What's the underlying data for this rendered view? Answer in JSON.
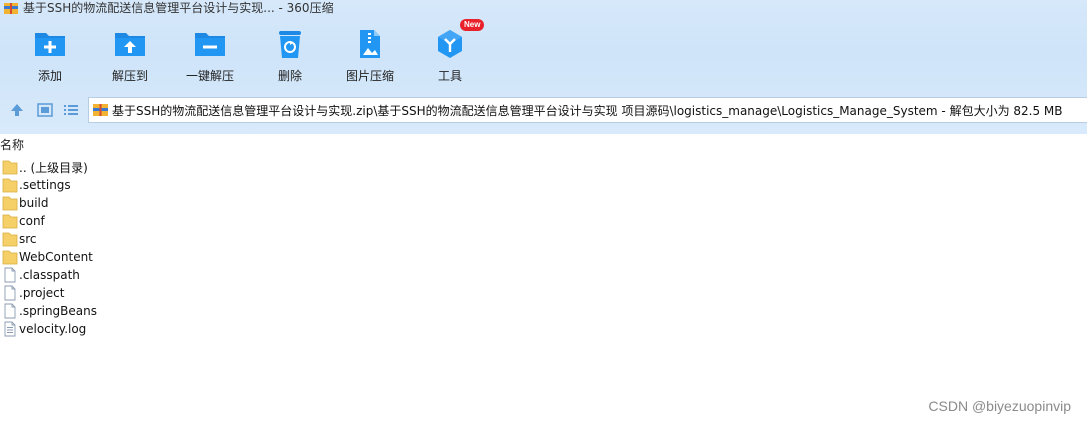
{
  "window": {
    "title": "基于SSH的物流配送信息管理平台设计与实现... - 360压缩"
  },
  "toolbar": {
    "add_label": "添加",
    "extract_to_label": "解压到",
    "one_click_extract_label": "一键解压",
    "delete_label": "删除",
    "image_compress_label": "图片压缩",
    "tools_label": "工具",
    "tools_badge": "New"
  },
  "address": {
    "path": "基于SSH的物流配送信息管理平台设计与实现.zip\\基于SSH的物流配送信息管理平台设计与实现 项目源码\\logistics_manage\\Logistics_Manage_System - 解包大小为 82.5 MB"
  },
  "columns": {
    "name": "名称"
  },
  "files": [
    {
      "name": ".. (上级目录)",
      "type": "folder"
    },
    {
      "name": ".settings",
      "type": "folder"
    },
    {
      "name": "build",
      "type": "folder"
    },
    {
      "name": "conf",
      "type": "folder"
    },
    {
      "name": "src",
      "type": "folder"
    },
    {
      "name": "WebContent",
      "type": "folder"
    },
    {
      "name": ".classpath",
      "type": "file"
    },
    {
      "name": ".project",
      "type": "file"
    },
    {
      "name": ".springBeans",
      "type": "file"
    },
    {
      "name": "velocity.log",
      "type": "textfile"
    }
  ],
  "watermark": "CSDN @biyezuopinvip",
  "colors": {
    "accent": "#1e88e5",
    "band": "#d6e8fa",
    "folder": "#f5cf67",
    "badge": "#e8212a"
  }
}
